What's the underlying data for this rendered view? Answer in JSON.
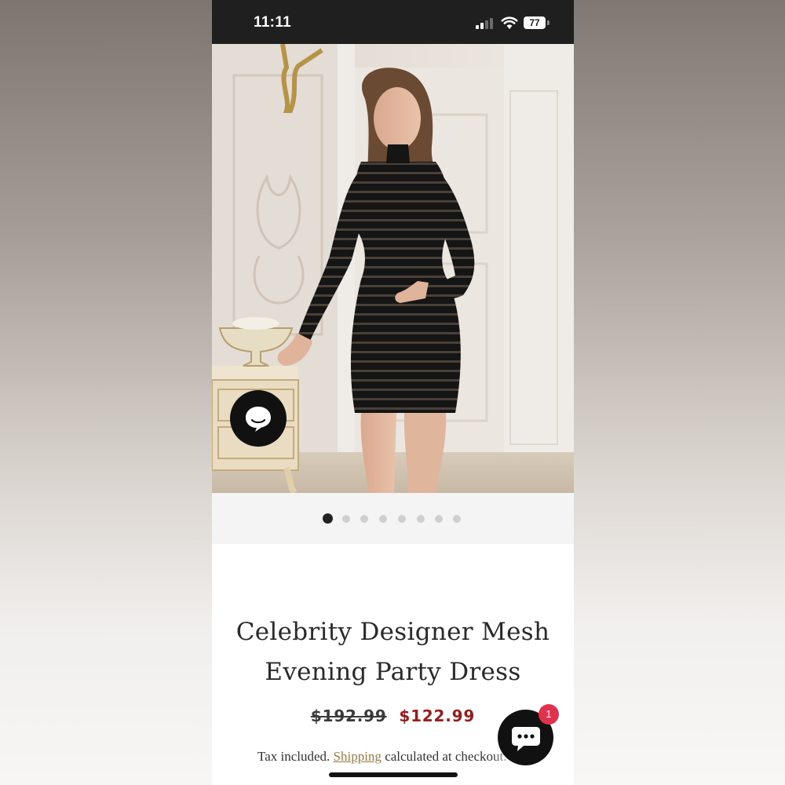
{
  "status_bar": {
    "time": "11:11",
    "battery": "77"
  },
  "gallery": {
    "image_alt": "Model wearing black sequin mesh long-sleeve mini dress",
    "dots_total": 8,
    "active_index": 0
  },
  "product": {
    "title_line1": "Celebrity Designer Mesh",
    "title_line2": "Evening Party Dress",
    "price_original": "$192.99",
    "price_sale": "$122.99",
    "tax_prefix": "Tax included.",
    "shipping_link": "Shipping",
    "tax_suffix": "calculated at checkout."
  },
  "chat": {
    "badge_count": "1"
  },
  "colors": {
    "sale": "#9b1b1b",
    "link": "#9a7b45",
    "badge": "#e0314e"
  }
}
